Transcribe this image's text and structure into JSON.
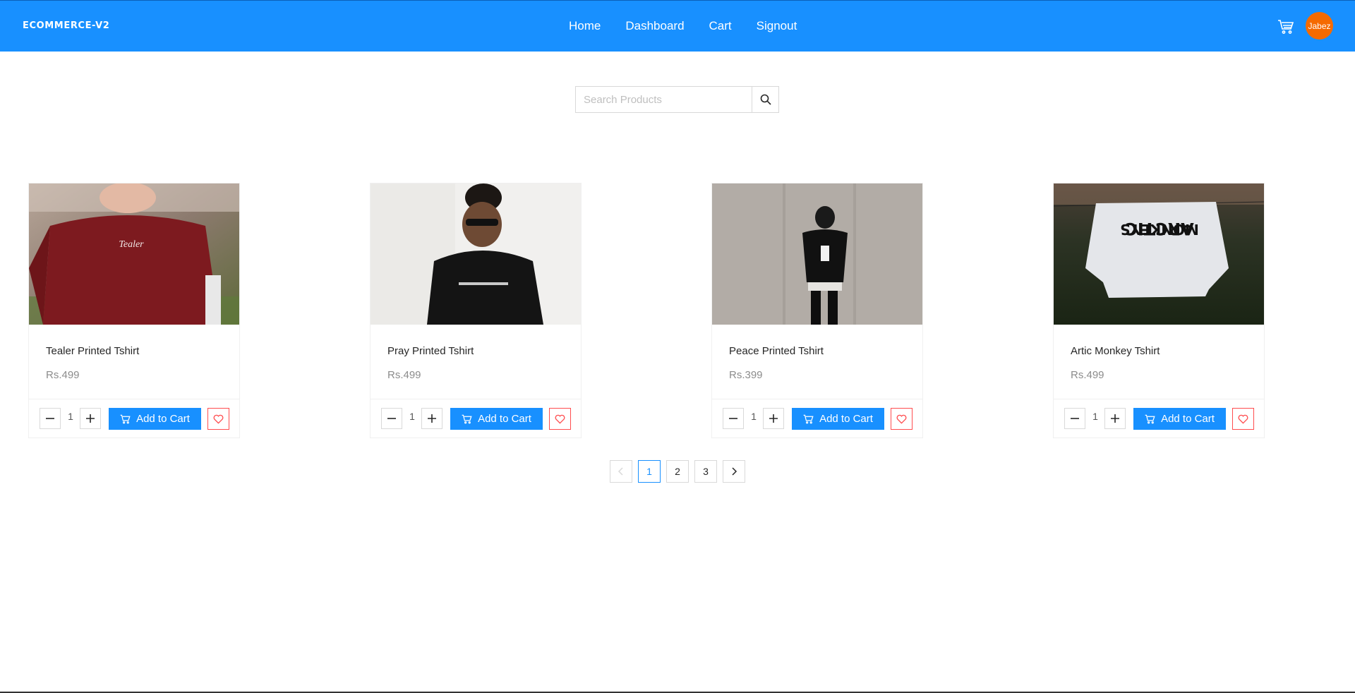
{
  "header": {
    "brand": "ECOMMERCE-V2",
    "nav": [
      "Home",
      "Dashboard",
      "Cart",
      "Signout"
    ],
    "avatar_name": "Jabez",
    "colors": {
      "primary": "#1890ff",
      "avatar": "#f56a00",
      "wishlist": "#ff4d4f"
    }
  },
  "search": {
    "placeholder": "Search Products",
    "value": ""
  },
  "products": [
    {
      "title": "Tealer Printed Tshirt",
      "price": "Rs.499",
      "qty": "1",
      "add_label": "Add to Cart",
      "image": "man-red-tshirt-photo"
    },
    {
      "title": "Pray Printed Tshirt",
      "price": "Rs.499",
      "qty": "1",
      "add_label": "Add to Cart",
      "image": "man-black-tshirt-photo"
    },
    {
      "title": "Peace Printed Tshirt",
      "price": "Rs.399",
      "qty": "1",
      "add_label": "Add to Cart",
      "image": "man-concrete-wall-photo"
    },
    {
      "title": "Artic Monkey Tshirt",
      "price": "Rs.499",
      "qty": "1",
      "add_label": "Add to Cart",
      "image": "hanging-white-tshirt-photo"
    }
  ],
  "pagination": {
    "pages": [
      "1",
      "2",
      "3"
    ],
    "current": "1"
  }
}
